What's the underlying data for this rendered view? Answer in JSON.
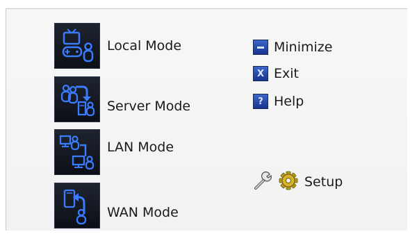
{
  "modes": [
    {
      "label": "Local Mode",
      "icon": "local-mode-icon"
    },
    {
      "label": "Server Mode",
      "icon": "server-mode-icon"
    },
    {
      "label": "LAN Mode",
      "icon": "lan-mode-icon"
    },
    {
      "label": "WAN Mode",
      "icon": "wan-mode-icon"
    }
  ],
  "actions": {
    "minimize_label": "Minimize",
    "exit_label": "Exit",
    "help_label": "Help",
    "help_icon_glyph": "?",
    "exit_icon_glyph": "X"
  },
  "setup": {
    "label": "Setup",
    "icons": [
      "wrench-icon",
      "gear-icon"
    ]
  },
  "colors": {
    "icon_background": "#141a24",
    "icon_glyph": "#2f6dff",
    "button_blue": "#2a4fb8"
  }
}
